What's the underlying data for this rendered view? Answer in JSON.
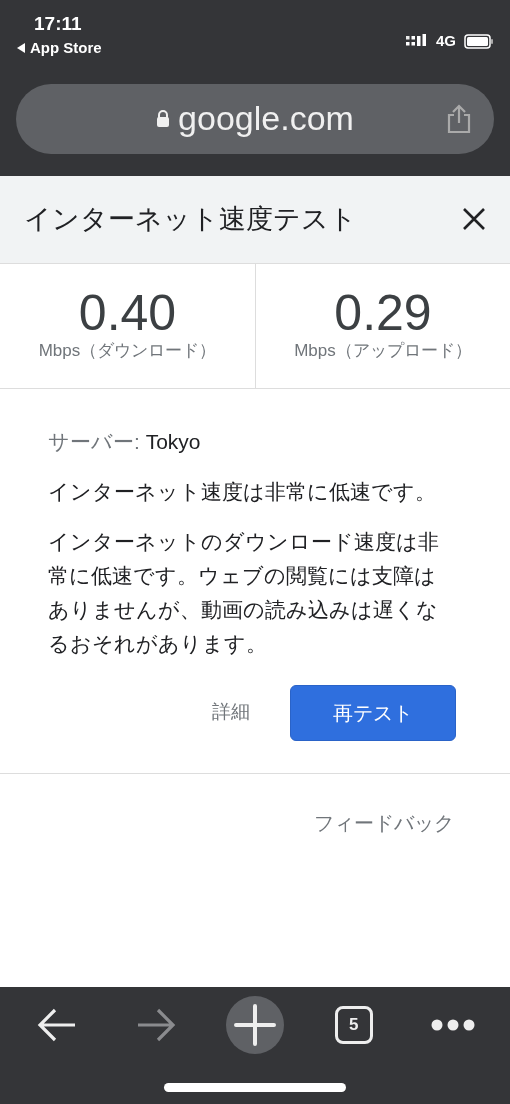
{
  "status_bar": {
    "time": "17:11",
    "back_app": "App Store",
    "network": "4G"
  },
  "address_bar": {
    "url": "google.com"
  },
  "panel": {
    "title": "インターネット速度テスト",
    "speeds": [
      {
        "value": "0.40",
        "unit": "Mbps（ダウンロード）"
      },
      {
        "value": "0.29",
        "unit": "Mbps（アップロード）"
      }
    ],
    "server_label": "サーバー:",
    "server": "Tokyo",
    "summary": "インターネット速度は非常に低速です。",
    "details": "インターネットのダウンロード速度は非常に低速です。ウェブの閲覧には支障はありませんが、動画の読み込みは遅くなるおそれがあります。",
    "details_link": "詳細",
    "retest_button": "再テスト",
    "feedback": "フィードバック"
  },
  "toolbar": {
    "buttons": [
      {
        "kind": "back",
        "disabled": false
      },
      {
        "kind": "forward",
        "disabled": true
      },
      {
        "kind": "new_tab",
        "disabled": false
      },
      {
        "kind": "tabs",
        "count": "5",
        "disabled": false
      },
      {
        "kind": "menu",
        "disabled": false
      }
    ]
  }
}
